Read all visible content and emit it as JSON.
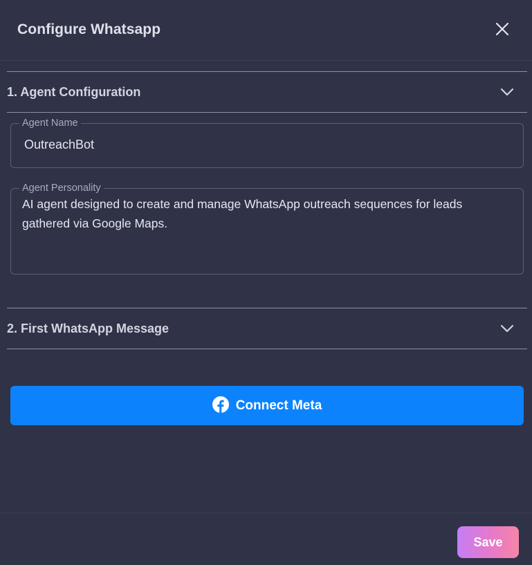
{
  "header": {
    "title": "Configure Whatsapp",
    "close_icon": "close-icon"
  },
  "sections": [
    {
      "label": "1. Agent Configuration",
      "expanded": true,
      "icon": "chevron-down-icon"
    },
    {
      "label": "2. First WhatsApp Message",
      "expanded": false,
      "icon": "chevron-down-icon"
    }
  ],
  "agent": {
    "name_label": "Agent Name",
    "name_value": "OutreachBot",
    "personality_label": "Agent Personality",
    "personality_value": "AI agent designed to create and manage WhatsApp outreach sequences for leads gathered via Google Maps."
  },
  "connect": {
    "label": "Connect Meta",
    "icon": "facebook-icon",
    "color": "#0c83fd"
  },
  "footer": {
    "save_label": "Save"
  }
}
